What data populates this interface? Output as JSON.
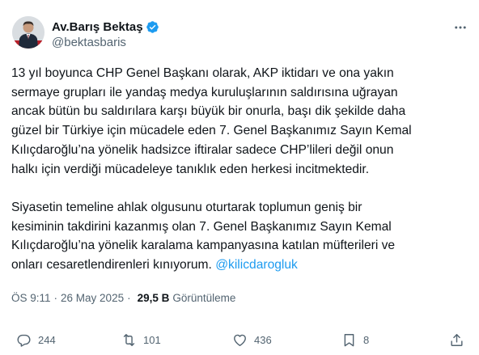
{
  "author": {
    "display_name": "Av.Barış Bektaş",
    "handle": "@bektasbaris",
    "verified_icon": "verified-badge-icon",
    "avatar_icon": "avatar-image"
  },
  "tweet": {
    "paragraph1_lines": [
      "13 yıl boyunca CHP Genel Başkanı olarak,  AKP iktidarı ve ona yakın",
      "sermaye grupları ile yandaş medya kuruluşlarının saldırısına uğrayan",
      "ancak bütün bu saldırılara karşı büyük bir onurla, başı dik şekilde daha",
      "güzel bir Türkiye için mücadele eden 7. Genel Başkanımız Sayın Kemal",
      "Kılıçdaroğlu’na yönelik hadsizce iftiralar sadece CHP’lileri değil onun",
      "halkı için verdiği mücadeleye tanıklık eden herkesi incitmektedir."
    ],
    "paragraph2_lines": [
      "Siyasetin temeline ahlak olgusunu oturtarak toplumun geniş bir",
      "kesiminin takdirini kazanmış olan 7. Genel Başkanımız Sayın Kemal",
      "Kılıçdaroğlu’na yönelik karalama kampanyasına katılan müfterileri ve"
    ],
    "paragraph2_last_line": "onları cesaretlendirenleri kınıyorum. ",
    "mention": "@kilicdarogluk"
  },
  "meta": {
    "time": "ÖS 9:11",
    "separator": "·",
    "date": "26 May 2025",
    "views_count": "29,5 B",
    "views_label": "Görüntüleme"
  },
  "actions": {
    "replies": "244",
    "reposts": "101",
    "likes": "436",
    "bookmarks": "8"
  },
  "colors": {
    "text": "#0f1419",
    "secondary": "#536471",
    "link": "#1d9bf0",
    "verified": "#1d9bf0"
  }
}
